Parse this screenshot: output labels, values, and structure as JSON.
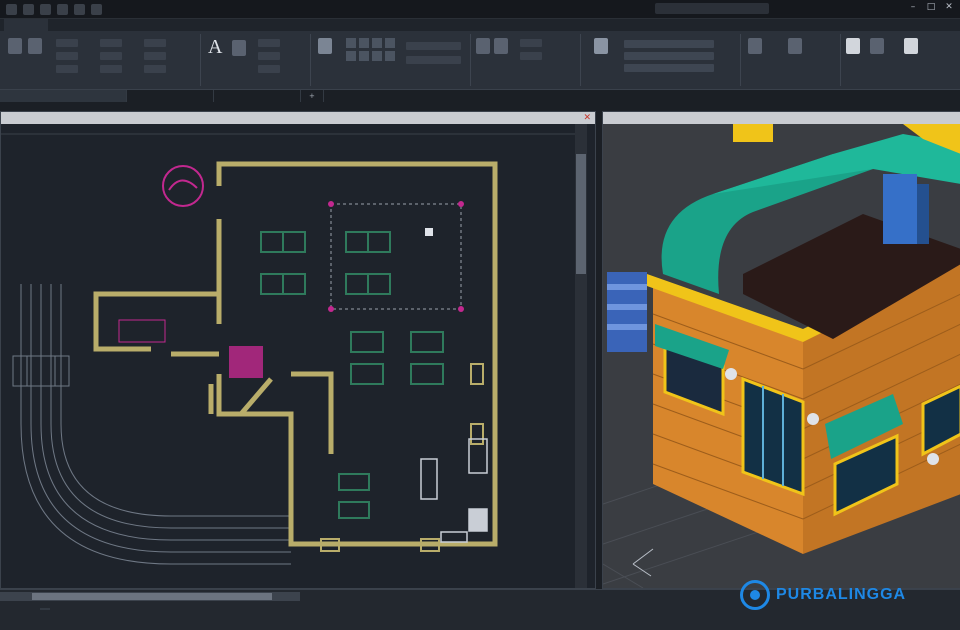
{
  "window": {
    "title": "",
    "search_placeholder": "",
    "user": ""
  },
  "ribbon_tabs": [],
  "ribbon_panels": [],
  "doc_tabs": [],
  "viewports": {
    "left": {
      "header": ""
    },
    "right": {
      "header": ""
    }
  },
  "status": {
    "model": "",
    "coords": ""
  },
  "watermark": {
    "text": "PURBALINGGA"
  },
  "colors": {
    "background": "#1e232b",
    "wall": "#b9ad6a",
    "furniture": "#2f7a5c",
    "magenta": "#c2288f",
    "accent": "#1e88e5",
    "roof_teal": "#1aa389",
    "brick": "#d8862c",
    "yellow": "#f0c419"
  }
}
